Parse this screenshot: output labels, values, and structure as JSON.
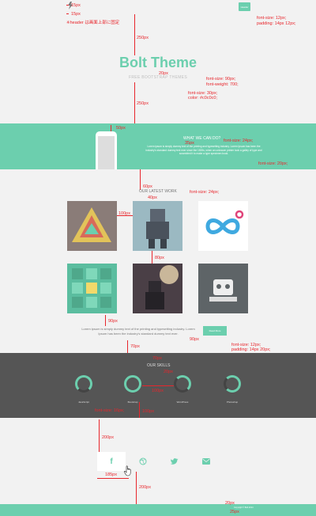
{
  "header": {
    "button_label": "Header",
    "ann_15a": "15px",
    "ann_15b": "15px",
    "ann_note": "※header は画面上部に固定",
    "ann_btn_font": "font-size: 12px;",
    "ann_btn_pad": "padding: 14px 12px;"
  },
  "hero": {
    "title": "Bolt Theme",
    "subtitle": "FREE BOOTSTRAP THEMES",
    "ann_250a": "250px",
    "ann_20": "20px",
    "ann_title_font": "font-size: 90px;",
    "ann_title_weight": "font-weight: 700;",
    "ann_sub_font": "font-size: 30px;",
    "ann_sub_color": "color: #c0c0c0;",
    "ann_250b": "250px"
  },
  "what_we_do": {
    "heading": "WHAT WE CAN DO?",
    "body": "Lorem ipsum is simply dummy text of the printing and typesetting industry. Lorem Ipsum has been the industry's standard dummy text ever since the 1500s, when an unknown printer took a galley of type and scrambled it to make a type specimen book.",
    "ann_50": "50px",
    "ann_35": "35px",
    "ann_h_font": "font-size: 24px;",
    "ann_p_font": "font-size: 20px;"
  },
  "work": {
    "heading": "OUR LATEST WORK",
    "ann_60": "60px",
    "ann_40": "40px",
    "ann_h_font": "font-size: 24px;",
    "ann_100": "100px",
    "ann_80": "80px"
  },
  "about": {
    "body": "Lorem ipsum is simply dummy text of the printing and typesetting industry. Lorem Ipsum has been the industry's standard dummy text ever.",
    "button_label": "Read More",
    "ann_90a": "90px",
    "ann_90b": "90px",
    "ann_btn_font": "font-size: 12px;",
    "ann_btn_pad": "padding: 14px 20px;",
    "ann_70": "70px"
  },
  "skills": {
    "heading": "OUR SKILLS",
    "ann_70": "70px",
    "ann_20": "20px",
    "ann_100": "100px",
    "ann_label_font": "font-size: 16px;",
    "ann_100b": "100px",
    "items": [
      {
        "label": "JavaScript"
      },
      {
        "label": "Bootstrap"
      },
      {
        "label": "WordPress"
      },
      {
        "label": "Photoshop"
      }
    ]
  },
  "social": {
    "ann_200a": "200px",
    "ann_185": "185px",
    "ann_200b": "200px",
    "icons": [
      "facebook-icon",
      "dribbble-icon",
      "twitter-icon",
      "mail-icon"
    ]
  },
  "footer": {
    "text": "Copyright © Bolt 2014",
    "ann_20": "20px",
    "ann_25": "25px"
  },
  "colors": {
    "accent": "#6ccfae",
    "dark": "#555555",
    "annotation": "#e8262c"
  }
}
